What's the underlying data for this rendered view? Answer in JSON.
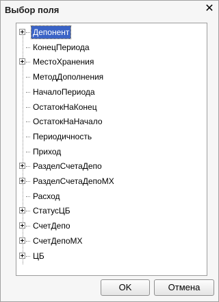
{
  "window": {
    "title": "Выбор поля"
  },
  "tree": {
    "items": [
      {
        "label": "Депонент",
        "expandable": true,
        "selected": true
      },
      {
        "label": "КонецПериода",
        "expandable": false,
        "selected": false
      },
      {
        "label": "МестоХранения",
        "expandable": true,
        "selected": false
      },
      {
        "label": "МетодДополнения",
        "expandable": false,
        "selected": false
      },
      {
        "label": "НачалоПериода",
        "expandable": false,
        "selected": false
      },
      {
        "label": "ОстатокНаКонец",
        "expandable": false,
        "selected": false
      },
      {
        "label": "ОстатокНаНачало",
        "expandable": false,
        "selected": false
      },
      {
        "label": "Периодичность",
        "expandable": false,
        "selected": false
      },
      {
        "label": "Приход",
        "expandable": false,
        "selected": false
      },
      {
        "label": "РазделСчетаДепо",
        "expandable": true,
        "selected": false
      },
      {
        "label": "РазделСчетаДепоМХ",
        "expandable": true,
        "selected": false
      },
      {
        "label": "Расход",
        "expandable": false,
        "selected": false
      },
      {
        "label": "СтатусЦБ",
        "expandable": true,
        "selected": false
      },
      {
        "label": "СчетДепо",
        "expandable": true,
        "selected": false
      },
      {
        "label": "СчетДепоМХ",
        "expandable": true,
        "selected": false
      },
      {
        "label": "ЦБ",
        "expandable": true,
        "selected": false
      }
    ]
  },
  "buttons": {
    "ok": "OK",
    "cancel": "Отмена"
  },
  "icons": {
    "close": "close-icon",
    "expander": "plus-box-icon"
  },
  "colors": {
    "selection": "#3a63c6"
  }
}
